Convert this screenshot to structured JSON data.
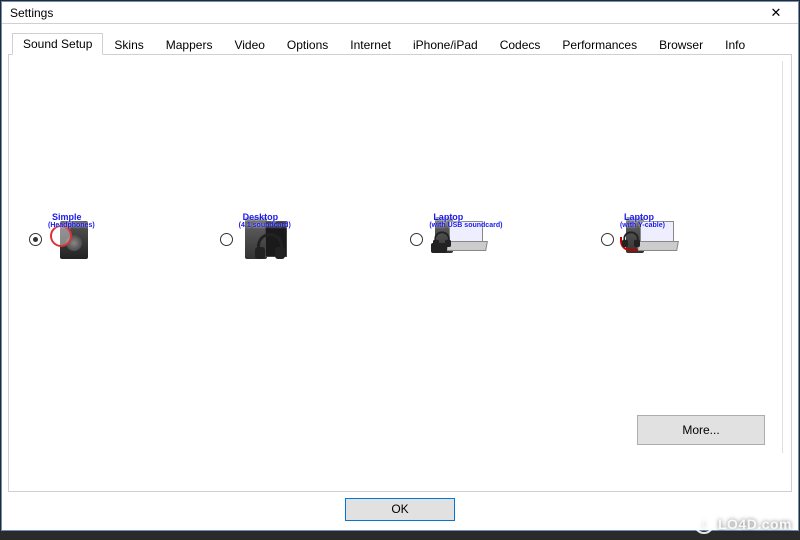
{
  "window": {
    "title": "Settings",
    "close": "✕"
  },
  "tabs": [
    "Sound Setup",
    "Skins",
    "Mappers",
    "Video",
    "Options",
    "Internet",
    "iPhone/iPad",
    "Codecs",
    "Performances",
    "Browser",
    "Info"
  ],
  "active_tab_index": 0,
  "sound_options": [
    {
      "title": "Simple",
      "subtitle": "(Headphones)",
      "selected": true,
      "kind": "simple"
    },
    {
      "title": "Desktop",
      "subtitle": "(4.1 soundcard)",
      "selected": false,
      "kind": "desktop"
    },
    {
      "title": "Laptop",
      "subtitle": "(with USB soundcard)",
      "selected": false,
      "kind": "laptop-usb"
    },
    {
      "title": "Laptop",
      "subtitle": "(with Y-cable)",
      "selected": false,
      "kind": "laptop-y"
    }
  ],
  "buttons": {
    "more": "More...",
    "ok": "OK"
  },
  "watermark": {
    "arrow": "↓",
    "text": "LO4D.com"
  }
}
